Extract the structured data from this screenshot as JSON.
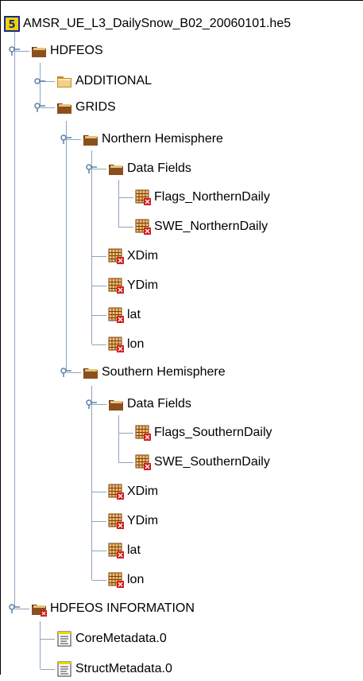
{
  "tree": {
    "root": {
      "label": "AMSR_UE_L3_DailySnow_B02_20060101.he5",
      "icon": "hdf5-file-icon"
    },
    "hdfeos": {
      "label": "HDFEOS",
      "additional": {
        "label": "ADDITIONAL"
      },
      "grids": {
        "label": "GRIDS",
        "northern": {
          "label": "Northern Hemisphere",
          "data_fields": {
            "label": "Data Fields",
            "items": [
              "Flags_NorthernDaily",
              "SWE_NorthernDaily"
            ]
          },
          "datasets": [
            "XDim",
            "YDim",
            "lat",
            "lon"
          ]
        },
        "southern": {
          "label": "Southern Hemisphere",
          "data_fields": {
            "label": "Data Fields",
            "items": [
              "Flags_SouthernDaily",
              "SWE_SouthernDaily"
            ]
          },
          "datasets": [
            "XDim",
            "YDim",
            "lat",
            "lon"
          ]
        }
      }
    },
    "hdfeos_information": {
      "label": "HDFEOS INFORMATION",
      "items": [
        "CoreMetadata.0",
        "StructMetadata.0"
      ]
    }
  },
  "colors": {
    "tree_line": "#8ea4bd",
    "folder_brown": "#6b3a12",
    "folder_tan": "#e7c27a",
    "dataset_red": "#d11b1b",
    "file_yellow": "#f2d200"
  }
}
